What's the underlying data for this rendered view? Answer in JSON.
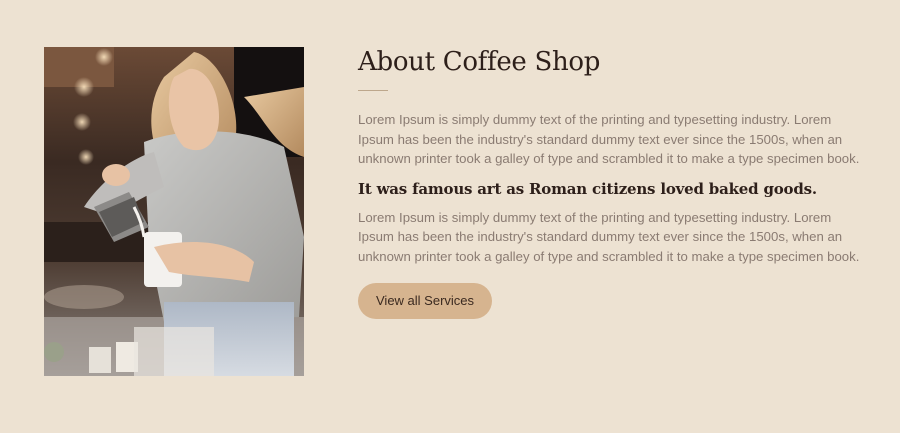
{
  "about": {
    "title": "About Coffee Shop",
    "paragraph_1": "Lorem Ipsum is simply dummy text of the printing and typesetting industry. Lorem Ipsum has been the industry's standard dummy text ever since the 1500s, when an unknown printer took a galley of type and scrambled it to make a type specimen book.",
    "subtitle": "It was famous art as Roman citizens loved baked goods.",
    "paragraph_2": "Lorem Ipsum is simply dummy text of the printing and typesetting industry. Lorem Ipsum has been the industry's standard dummy text ever since the 1500s, when an unknown printer took a galley of type and scrambled it to make a type specimen book.",
    "button_label": "View all Services"
  },
  "colors": {
    "background": "#ede2d2",
    "button": "#d6b48f",
    "heading": "#2d1f1a",
    "body_text": "#8a7b72"
  }
}
